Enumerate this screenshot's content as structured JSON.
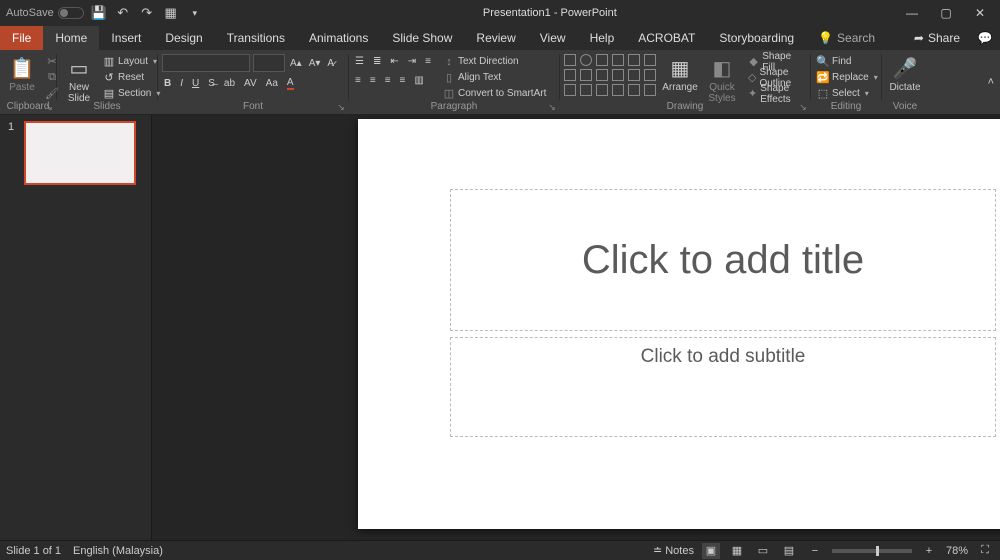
{
  "title": "Presentation1 - PowerPoint",
  "titlebar": {
    "autosave_label": "AutoSave",
    "autosave_state": "Off"
  },
  "tabs": {
    "file": "File",
    "list": [
      "Home",
      "Insert",
      "Design",
      "Transitions",
      "Animations",
      "Slide Show",
      "Review",
      "View",
      "Help",
      "ACROBAT",
      "Storyboarding"
    ],
    "active": "Home",
    "search_placeholder": "Search",
    "share": "Share"
  },
  "ribbon": {
    "clipboard": {
      "label": "Clipboard",
      "paste": "Paste"
    },
    "slides": {
      "label": "Slides",
      "new_slide": "New\nSlide",
      "layout": "Layout",
      "reset": "Reset",
      "section": "Section"
    },
    "font": {
      "label": "Font"
    },
    "paragraph": {
      "label": "Paragraph",
      "text_direction": "Text Direction",
      "align_text": "Align Text",
      "smartart": "Convert to SmartArt"
    },
    "drawing": {
      "label": "Drawing",
      "arrange": "Arrange",
      "quick_styles": "Quick\nStyles",
      "shape_fill": "Shape Fill",
      "shape_outline": "Shape Outline",
      "shape_effects": "Shape Effects"
    },
    "editing": {
      "label": "Editing",
      "find": "Find",
      "replace": "Replace",
      "select": "Select"
    },
    "voice": {
      "label": "Voice",
      "dictate": "Dictate"
    }
  },
  "slide": {
    "number": "1",
    "title_placeholder": "Click to add title",
    "subtitle_placeholder": "Click to add subtitle"
  },
  "status": {
    "slide_of": "Slide 1 of 1",
    "language": "English (Malaysia)",
    "notes": "Notes",
    "zoom": "78%"
  }
}
